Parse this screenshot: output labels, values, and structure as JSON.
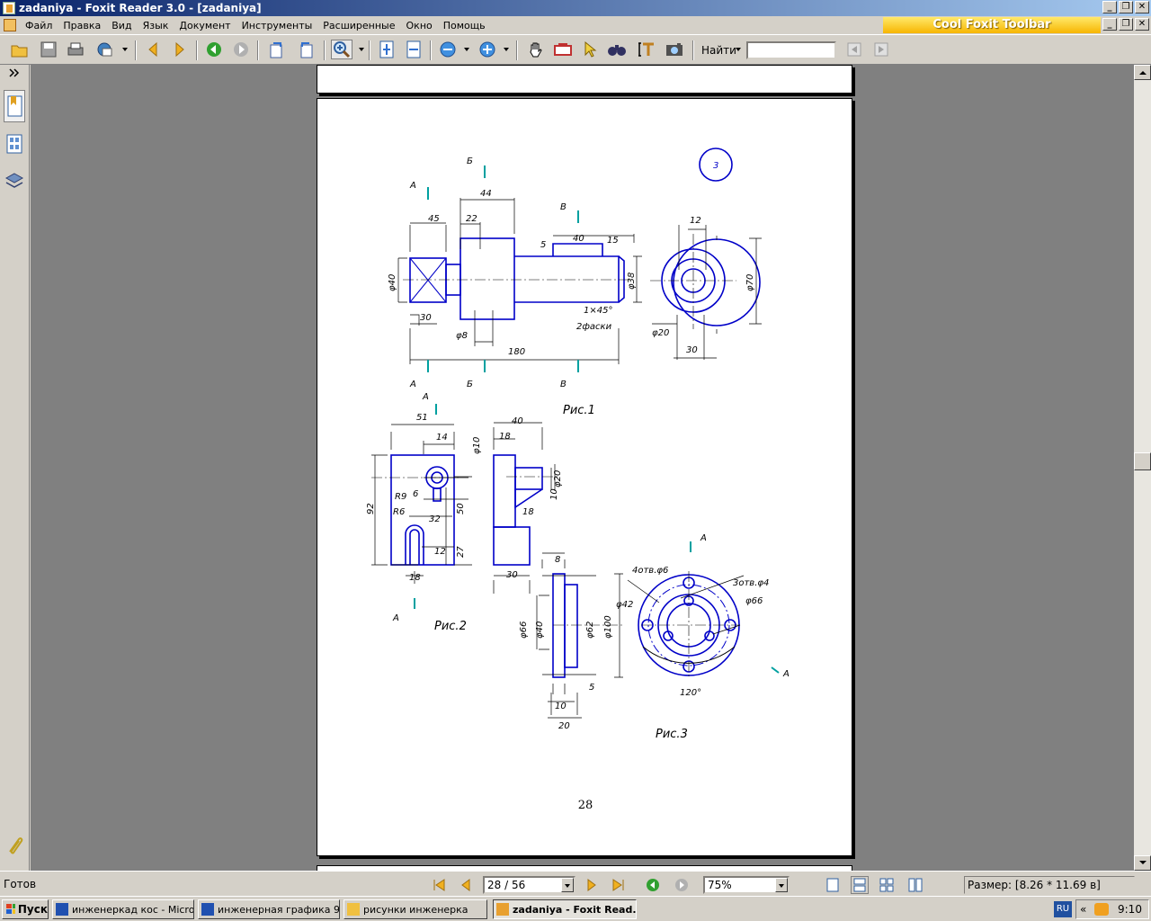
{
  "window": {
    "title": "zadaniya - Foxit Reader 3.0 - [zadaniya]",
    "buttons": [
      "_",
      "❐",
      "✕"
    ]
  },
  "menu": {
    "items": [
      "Файл",
      "Правка",
      "Вид",
      "Язык",
      "Документ",
      "Инструменты",
      "Расширенные",
      "Окно",
      "Помощь"
    ],
    "banner": "Cool Foxit Toolbar"
  },
  "toolbar": {
    "find_label": "Найти",
    "find_value": "",
    "icons": [
      "open-icon",
      "save-icon",
      "print-icon",
      "email-icon",
      "prev-page-icon",
      "next-page-icon",
      "back-icon",
      "forward-icon",
      "rotate-left-icon",
      "rotate-right-icon",
      "zoom-in-tool-icon",
      "fit-page-icon",
      "fit-width-icon",
      "zoom-out-icon",
      "zoom-in-icon",
      "hand-icon",
      "snapshot-icon",
      "select-icon",
      "find-icon",
      "text-select-icon",
      "image-select-icon",
      "find-prev-icon",
      "find-next-icon"
    ]
  },
  "document": {
    "page_number": "28",
    "labels": {
      "A": "А",
      "B": "Б",
      "V": "В",
      "fig1": "Рис.1",
      "fig2": "Рис.2",
      "fig3": "Рис.3",
      "sheet": "3",
      "d44": "44",
      "d45": "45",
      "d22": "22",
      "d40": "40",
      "d15": "15",
      "d5": "5",
      "d12": "12",
      "d30": "30",
      "d180": "180",
      "phi40": "φ40",
      "phi38": "φ38",
      "phi8": "φ8",
      "phi70": "φ70",
      "phi20": "φ20",
      "chamfer": "1×45°",
      "chamfer2": "2фаски",
      "d51": "51",
      "d14": "14",
      "d92": "92",
      "d50": "50",
      "d32": "32",
      "d27": "27",
      "d18": "18",
      "d6": "6",
      "r9": "R9",
      "r6": "R6",
      "phi10": "φ10",
      "d10": "10",
      "d8": "8",
      "phi66": "φ66",
      "phi62": "φ62",
      "phi100": "φ100",
      "d20": "20",
      "phi42": "φ42",
      "holes1": "4отв.φ6",
      "holes2": "3отв.φ4",
      "angle120": "120°"
    }
  },
  "status": {
    "ready": "Готов",
    "page": "28 / 56",
    "zoom": "75%",
    "size": "Размер: [8.26 * 11.69 в]"
  },
  "taskbar": {
    "start": "Пуск",
    "tasks": [
      "инженеркад кос - Micro...",
      "инженерная графика 9...",
      "рисунки инженерка",
      "zadaniya - Foxit Read..."
    ],
    "lang": "RU",
    "time": "9:10"
  }
}
